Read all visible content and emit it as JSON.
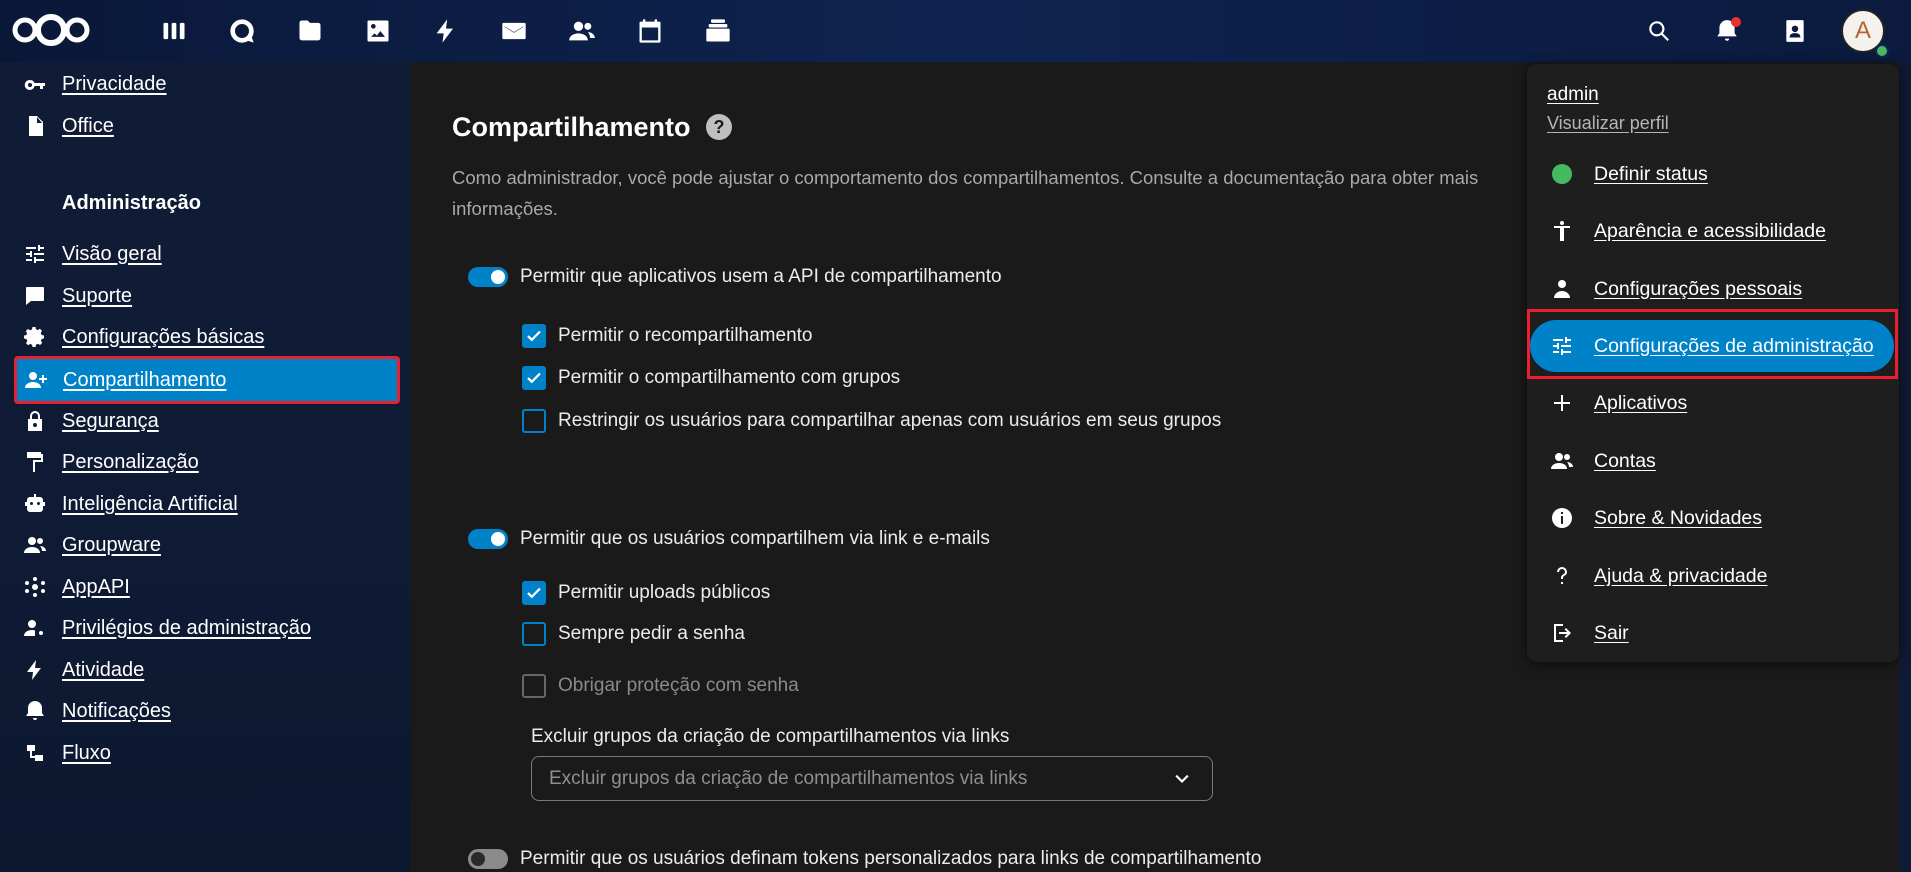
{
  "topbar": {
    "apps": [
      {
        "name": "dashboard-icon"
      },
      {
        "name": "talk-icon"
      },
      {
        "name": "files-icon"
      },
      {
        "name": "photos-icon"
      },
      {
        "name": "activity-icon"
      },
      {
        "name": "mail-icon"
      },
      {
        "name": "contacts-icon"
      },
      {
        "name": "calendar-icon"
      },
      {
        "name": "deck-icon"
      }
    ],
    "avatar_letter": "A"
  },
  "sidebar": {
    "items_top": [
      {
        "label": "Privacidade",
        "icon": "key-icon"
      },
      {
        "label": "Office",
        "icon": "document-icon"
      }
    ],
    "section_title": "Administração",
    "items": [
      {
        "label": "Visão geral",
        "icon": "tune-icon"
      },
      {
        "label": "Suporte",
        "icon": "chat-icon"
      },
      {
        "label": "Configurações básicas",
        "icon": "gear-icon"
      },
      {
        "label": "Compartilhamento",
        "icon": "share-user-icon",
        "active": true
      },
      {
        "label": "Segurança",
        "icon": "lock-icon"
      },
      {
        "label": "Personalização",
        "icon": "paint-roller-icon"
      },
      {
        "label": "Inteligência Artificial",
        "icon": "robot-icon"
      },
      {
        "label": "Groupware",
        "icon": "group-icon"
      },
      {
        "label": "AppAPI",
        "icon": "api-icon"
      },
      {
        "label": "Privilégios de administração",
        "icon": "admin-privileges-icon"
      },
      {
        "label": "Atividade",
        "icon": "lightning-icon"
      },
      {
        "label": "Notificações",
        "icon": "bell-icon"
      },
      {
        "label": "Fluxo",
        "icon": "flow-icon"
      }
    ]
  },
  "main": {
    "title": "Compartilhamento",
    "description": "Como administrador, você pode ajustar o comportamento dos compartilhamentos. Consulte a documentação para obter mais informações.",
    "toggle1": "Permitir que aplicativos usem a API de compartilhamento",
    "check1": "Permitir o recompartilhamento",
    "check2": "Permitir o compartilhamento com grupos",
    "check3": "Restringir os usuários para compartilhar apenas com usuários em seus grupos",
    "toggle2": "Permitir que os usuários compartilhem via link e e-mails",
    "check4": "Permitir uploads públicos",
    "check5": "Sempre pedir a senha",
    "check6": "Obrigar proteção com senha",
    "exclude_label": "Excluir grupos da criação de compartilhamentos via links",
    "exclude_placeholder": "Excluir grupos da criação de compartilhamentos via links",
    "toggle3": "Permitir que os usuários definam tokens personalizados para links de compartilhamento"
  },
  "menu": {
    "user": "admin",
    "profile": "Visualizar perfil",
    "items": [
      {
        "label": "Definir status",
        "icon": "status-online-icon"
      },
      {
        "label": "Aparência e acessibilidade",
        "icon": "accessibility-icon"
      },
      {
        "label": "Configurações pessoais",
        "icon": "person-icon"
      },
      {
        "label": "Configurações de administração",
        "icon": "tune-icon",
        "active": true
      },
      {
        "label": "Aplicativos",
        "icon": "plus-icon"
      },
      {
        "label": "Contas",
        "icon": "group-icon"
      },
      {
        "label": "Sobre & Novidades",
        "icon": "info-icon"
      },
      {
        "label": "Ajuda & privacidade",
        "icon": "question-icon"
      },
      {
        "label": "Sair",
        "icon": "logout-icon"
      }
    ]
  },
  "colors": {
    "primary": "#0082c9",
    "highlight_border": "#e9202d",
    "status_online": "#46ba61"
  }
}
